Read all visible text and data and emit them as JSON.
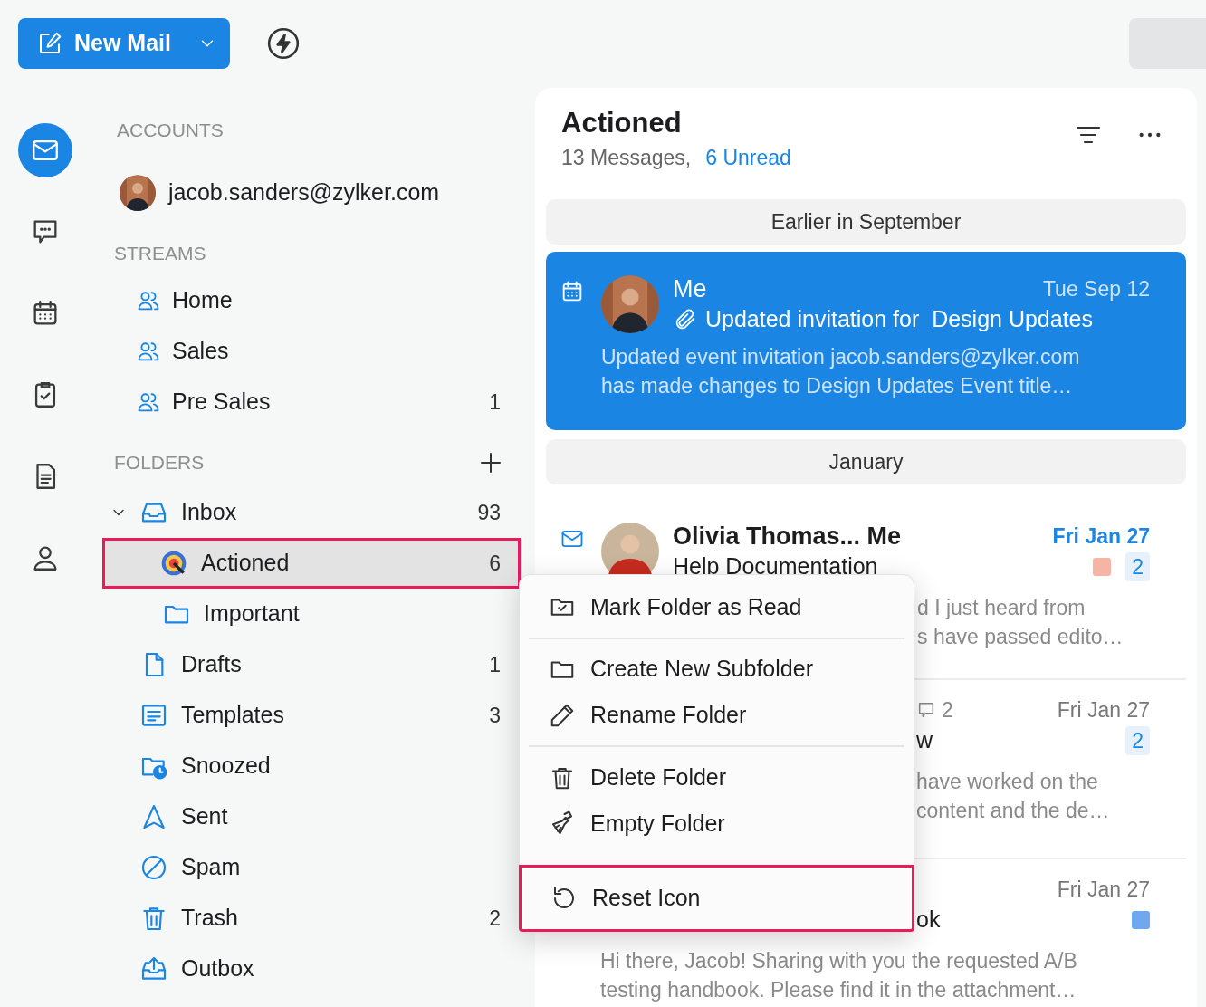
{
  "toolbar": {
    "new_mail": "New Mail"
  },
  "rail": [
    {
      "kind": "mail",
      "selected": true
    },
    {
      "kind": "chat",
      "selected": false
    },
    {
      "kind": "calendar",
      "selected": false
    },
    {
      "kind": "tasks",
      "selected": false
    },
    {
      "kind": "notes",
      "selected": false
    },
    {
      "kind": "contacts",
      "selected": false
    }
  ],
  "accounts": {
    "heading": "ACCOUNTS",
    "items": [
      {
        "email": "jacob.sanders@zylker.com"
      }
    ]
  },
  "streams": {
    "heading": "STREAMS",
    "items": [
      {
        "label": "Home"
      },
      {
        "label": "Sales"
      },
      {
        "label": "Pre Sales",
        "count": "1"
      }
    ]
  },
  "folders": {
    "heading": "FOLDERS",
    "items": [
      {
        "kind": "inbox",
        "label": "Inbox",
        "count": "93",
        "expanded": true,
        "selected": false,
        "children": [
          {
            "kind": "actioned",
            "label": "Actioned",
            "count": "6",
            "selected": true,
            "highlighted": true
          },
          {
            "kind": "folder",
            "label": "Important",
            "selected": false,
            "highlighted": false
          }
        ]
      },
      {
        "kind": "drafts",
        "label": "Drafts",
        "count": "1",
        "selected": false
      },
      {
        "kind": "templates",
        "label": "Templates",
        "count": "3",
        "selected": false
      },
      {
        "kind": "snoozed",
        "label": "Snoozed",
        "selected": false
      },
      {
        "kind": "sent",
        "label": "Sent",
        "selected": false
      },
      {
        "kind": "spam",
        "label": "Spam",
        "selected": false
      },
      {
        "kind": "trash",
        "label": "Trash",
        "count": "2",
        "selected": false
      },
      {
        "kind": "outbox",
        "label": "Outbox",
        "selected": false
      }
    ]
  },
  "list": {
    "title": "Actioned",
    "message_count": "13 Messages,",
    "unread": "6 Unread",
    "groups": [
      {
        "label": "Earlier in September",
        "messages": [
          {
            "kind": "full",
            "is_event": true,
            "selected": true,
            "unread": false,
            "sender": "Me",
            "date": "Tue Sep 12",
            "attachment": true,
            "subject": "Updated invitation for  Design Updates",
            "preview_covered": false,
            "preview": [
              "Updated event invitation jacob.sanders@zylker.com",
              "has made changes to Design Updates Event title…"
            ]
          }
        ]
      },
      {
        "label": "January",
        "messages": [
          {
            "kind": "full",
            "is_event": false,
            "selected": false,
            "unread": true,
            "sender": "Olivia Thomas... Me",
            "date": "Fri Jan 27",
            "attachment": false,
            "subject": "Help Documentation",
            "color": "#f6b4a4",
            "count": "2",
            "preview_covered": true,
            "preview": [
              "d I just heard from",
              "s have passed edito…"
            ]
          },
          {
            "kind": "covered",
            "selected": false,
            "unread": false,
            "comments": "2",
            "date": "Fri Jan 27",
            "subject": "w",
            "count": "2",
            "preview_covered": true,
            "preview": [
              "have worked on the",
              "content and the de…"
            ]
          },
          {
            "kind": "covered",
            "selected": false,
            "unread": false,
            "date": "Fri Jan 27",
            "subject": "ok",
            "color": "#6fa8ee",
            "preview_covered": false,
            "preview": [
              "Hi there, Jacob! Sharing with you the requested A/B",
              "testing handbook. Please find it in the attachment…"
            ]
          }
        ]
      }
    ]
  },
  "context_menu": {
    "sections": [
      [
        {
          "kind": "mark-read",
          "label": "Mark Folder as Read",
          "highlighted": false
        }
      ],
      [
        {
          "kind": "new-folder",
          "label": "Create New Subfolder",
          "highlighted": false
        },
        {
          "kind": "rename",
          "label": "Rename Folder",
          "highlighted": false
        }
      ],
      [
        {
          "kind": "delete",
          "label": "Delete Folder",
          "highlighted": false
        },
        {
          "kind": "empty",
          "label": "Empty Folder",
          "highlighted": false
        }
      ],
      [
        {
          "kind": "reset",
          "label": "Reset Icon",
          "highlighted": true
        }
      ]
    ]
  }
}
